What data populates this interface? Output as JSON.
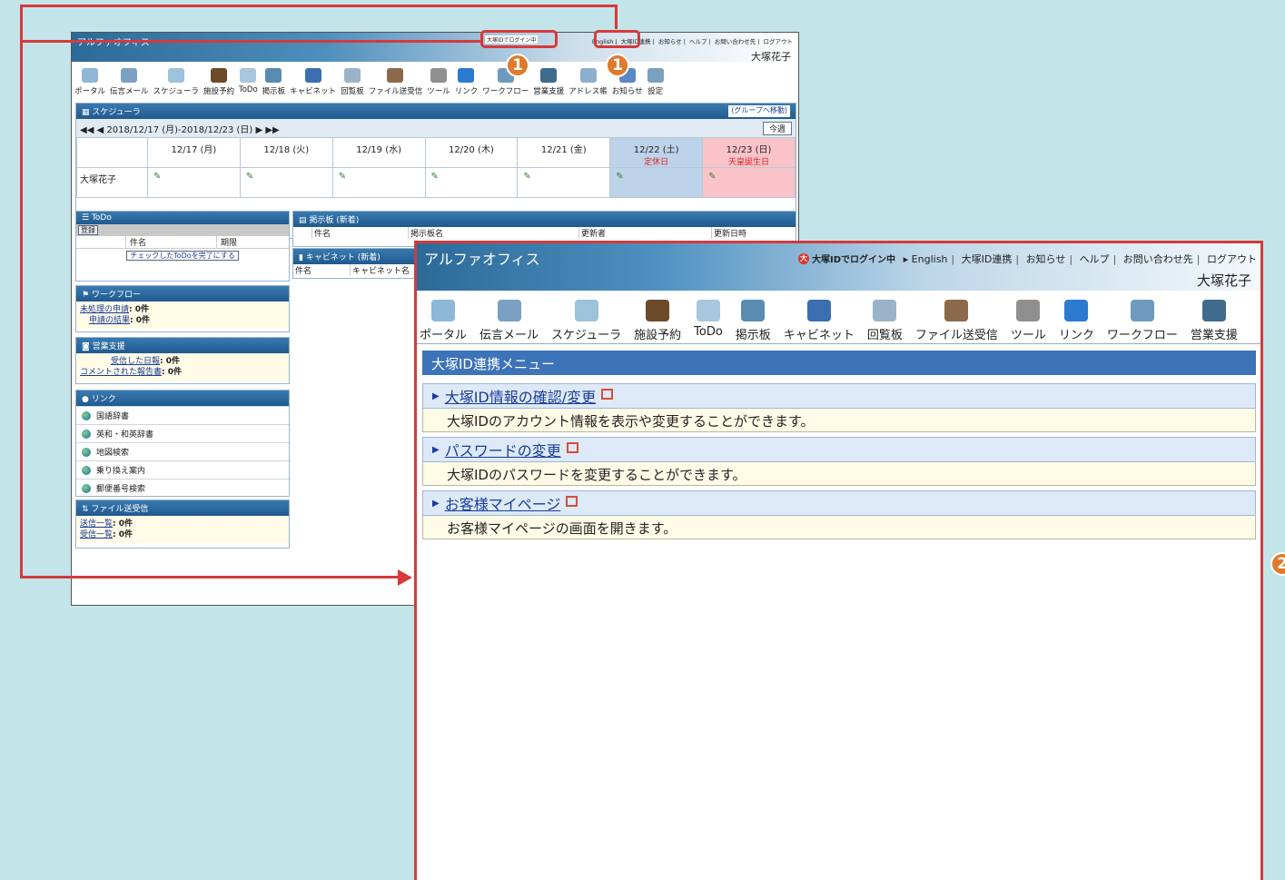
{
  "back": {
    "app_title": "アルファオフィス",
    "badge": "大塚IDでログイン中",
    "toplinks": [
      "English",
      "大塚ID連携",
      "お知らせ",
      "ヘルプ",
      "お問い合わせ先",
      "ログアウト"
    ],
    "user": "大塚花子",
    "toolbar": [
      "ポータル",
      "伝言メール",
      "スケジューラ",
      "施設予約",
      "ToDo",
      "掲示板",
      "キャビネット",
      "回覧板",
      "ファイル送受信",
      "ツール",
      "リンク",
      "ワークフロー",
      "営業支援",
      "アドレス帳",
      "お知らせ",
      "設定"
    ],
    "scheduler": {
      "title": "スケジューラ",
      "group_move": "(グループへ移動)",
      "range": "2018/12/17 (月)-2018/12/23 (日)",
      "today": "今週",
      "days": [
        "12/17 (月)",
        "12/18 (火)",
        "12/19 (水)",
        "12/20 (木)",
        "12/21 (金)",
        "12/22 (土)",
        "12/23 (日)"
      ],
      "day_notes": [
        "",
        "",
        "",
        "",
        "",
        "定休日",
        "天皇誕生日"
      ],
      "member": "大塚花子"
    },
    "todo": {
      "title": "ToDo",
      "register": "登録",
      "col_name": "件名",
      "col_due": "期限",
      "complete_btn": "チェックしたToDoを完了にする"
    },
    "bbs": {
      "title": "掲示板 (新着)",
      "cols": [
        "件名",
        "掲示板名",
        "更新者",
        "更新日時"
      ]
    },
    "cabinet": {
      "title": "キャビネット (新着)",
      "cols": [
        "件名",
        "キャビネット名"
      ]
    },
    "workflow": {
      "title": "ワークフロー",
      "rows": [
        {
          "link": "未処理の申請",
          "value": ": 0件"
        },
        {
          "link": "申請の結果",
          "value": ": 0件"
        }
      ]
    },
    "sales": {
      "title": "営業支援",
      "rows": [
        {
          "link": "受信した日報",
          "value": ": 0件"
        },
        {
          "link": "コメントされた報告書",
          "value": ": 0件"
        }
      ]
    },
    "links": {
      "title": "リンク",
      "items": [
        "国語辞書",
        "英和・和英辞書",
        "地図検索",
        "乗り換え案内",
        "郵便番号検索"
      ]
    },
    "filetransfer": {
      "title": "ファイル送受信",
      "rows": [
        {
          "link": "送信一覧",
          "value": ": 0件"
        },
        {
          "link": "受信一覧",
          "value": ": 0件"
        }
      ]
    }
  },
  "front": {
    "app_title": "アルファオフィス",
    "badge": "大塚IDでログイン中",
    "toplinks": [
      "English",
      "大塚ID連携",
      "お知らせ",
      "ヘルプ",
      "お問い合わせ先",
      "ログアウト"
    ],
    "user": "大塚花子",
    "toolbar": [
      "ポータル",
      "伝言メール",
      "スケジューラ",
      "施設予約",
      "ToDo",
      "掲示板",
      "キャビネット",
      "回覧板",
      "ファイル送受信",
      "ツール",
      "リンク",
      "ワークフロー",
      "営業支援"
    ],
    "menu_title": "大塚ID連携メニュー",
    "items": [
      {
        "title": "大塚ID情報の確認/変更",
        "desc": "大塚IDのアカウント情報を表示や変更することができます。"
      },
      {
        "title": "パスワードの変更",
        "desc": "大塚IDのパスワードを変更することができます。"
      },
      {
        "title": "お客様マイページ",
        "desc": "お客様マイページの画面を開きます。"
      }
    ]
  },
  "annotations": {
    "markers": [
      "1",
      "1",
      "2"
    ],
    "marker_color": "#e07a2c",
    "line_color": "#d63a3a"
  },
  "icon_colors": [
    "#8fb7d8",
    "#7ba0c4",
    "#9cc3d9",
    "#6b4b2a",
    "#a8c7de",
    "#5a8bb0",
    "#3b6fb0",
    "#9bb3c9",
    "#8a6a4a",
    "#8f8f8f",
    "#2a7bd0",
    "#6f9ac0",
    "#3e6b8e",
    "#8faecb",
    "#5b87c7",
    "#7aa0c0"
  ]
}
